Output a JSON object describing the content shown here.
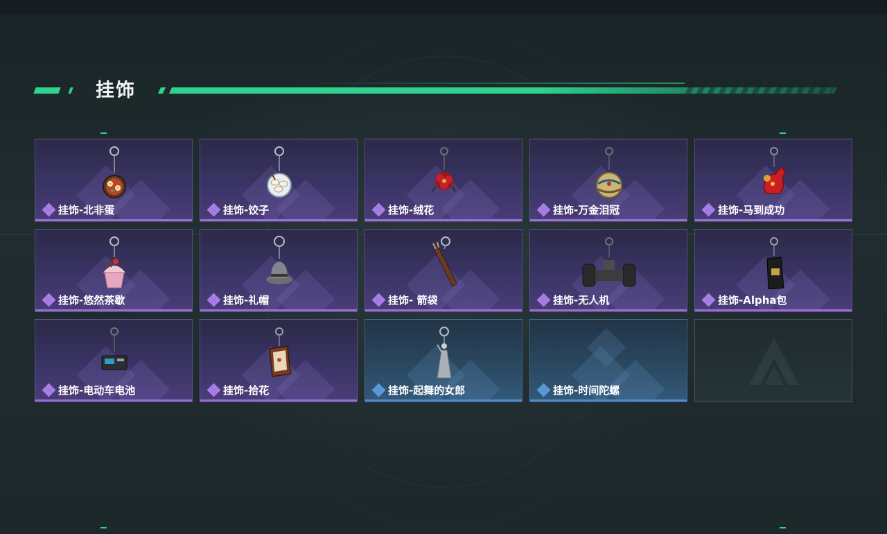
{
  "section": {
    "title": "挂饰"
  },
  "colors": {
    "accent": "#2fd38e",
    "purple_rarity": "#9b6cd8",
    "blue_rarity": "#4f8cc9"
  },
  "items": [
    {
      "label": "挂饰-北非蛋",
      "rarity": "purple",
      "icon": "shakshuka-charm-icon"
    },
    {
      "label": "挂饰-饺子",
      "rarity": "purple",
      "icon": "dumpling-plate-charm-icon"
    },
    {
      "label": "挂饰-绒花",
      "rarity": "purple",
      "icon": "velvet-flower-charm-icon"
    },
    {
      "label": "挂饰-万金泪冠",
      "rarity": "purple",
      "icon": "jeweled-crown-charm-icon"
    },
    {
      "label": "挂饰-马到成功",
      "rarity": "purple",
      "icon": "red-horse-charm-icon"
    },
    {
      "label": "挂饰-悠然茶歇",
      "rarity": "purple",
      "icon": "cupcake-charm-icon"
    },
    {
      "label": "挂饰-礼帽",
      "rarity": "purple",
      "icon": "fedora-hat-charm-icon"
    },
    {
      "label": "挂饰- 箭袋",
      "rarity": "purple",
      "icon": "quiver-charm-icon"
    },
    {
      "label": "挂饰-无人机",
      "rarity": "purple",
      "icon": "drone-charm-icon"
    },
    {
      "label": "挂饰-Alpha包",
      "rarity": "purple",
      "icon": "alpha-bag-charm-icon"
    },
    {
      "label": "挂饰-电动车电池",
      "rarity": "purple",
      "icon": "ebike-battery-charm-icon"
    },
    {
      "label": "挂饰-拾花",
      "rarity": "purple",
      "icon": "picture-frame-charm-icon"
    },
    {
      "label": "挂饰-起舞的女郎",
      "rarity": "blue",
      "icon": "dancing-lady-charm-icon"
    },
    {
      "label": "挂饰-时间陀螺",
      "rarity": "blue",
      "icon": "time-top-charm-icon"
    }
  ]
}
